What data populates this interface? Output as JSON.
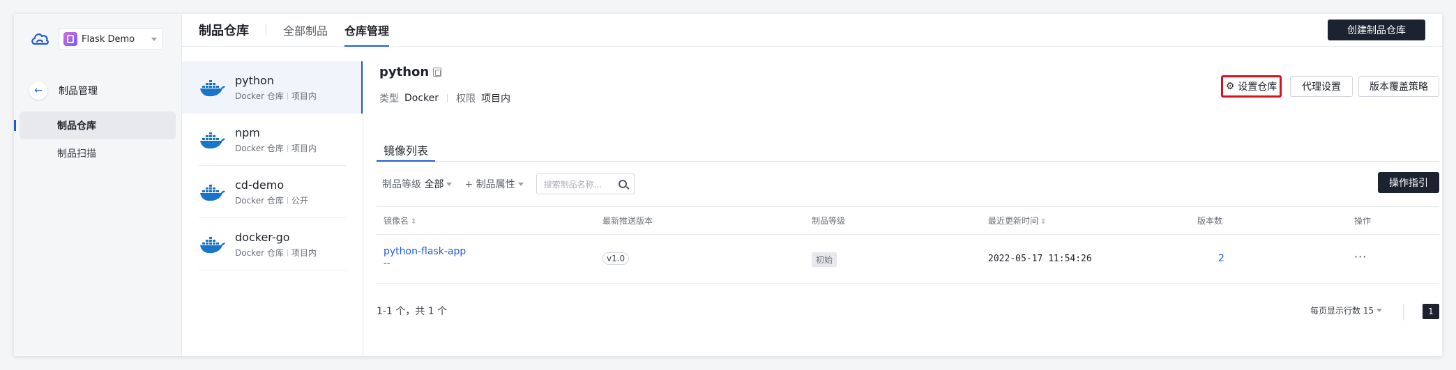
{
  "project": {
    "name": "Flask Demo"
  },
  "nav": {
    "back_label": "制品管理",
    "items": [
      {
        "label": "制品仓库",
        "active": true
      },
      {
        "label": "制品扫描",
        "active": false
      }
    ]
  },
  "header": {
    "title": "制品仓库",
    "tabs": [
      {
        "label": "全部制品",
        "active": false
      },
      {
        "label": "仓库管理",
        "active": true
      }
    ],
    "create_button": "创建制品仓库"
  },
  "repos": [
    {
      "name": "python",
      "type": "Docker 仓库",
      "scope": "项目内"
    },
    {
      "name": "npm",
      "type": "Docker 仓库",
      "scope": "项目内"
    },
    {
      "name": "cd-demo",
      "type": "Docker 仓库",
      "scope": "公开"
    },
    {
      "name": "docker-go",
      "type": "Docker 仓库",
      "scope": "项目内"
    }
  ],
  "detail": {
    "name": "python",
    "type_label": "类型",
    "type_value": "Docker",
    "perm_label": "权限",
    "perm_value": "项目内",
    "buttons": {
      "settings": "设置仓库",
      "proxy": "代理设置",
      "override": "版本覆盖策略"
    },
    "sub_tab": "镜像列表",
    "filters": {
      "level_label": "制品等级",
      "level_value": "全部",
      "attr_label": "+ 制品属性",
      "search_placeholder": "搜索制品名称..."
    },
    "guide_button": "操作指引",
    "table": {
      "headers": [
        "镜像名",
        "最新推送版本",
        "制品等级",
        "最近更新时间",
        "版本数",
        "操作"
      ],
      "rows": [
        {
          "name": "python-flask-app",
          "desc": "--",
          "version": "v1.0",
          "level": "初始",
          "updated": "2022-05-17 11:54:26",
          "count": "2",
          "action": "···"
        }
      ]
    },
    "footer": {
      "total": "1-1 个，共 1 个",
      "page_size": "每页显示行数 15",
      "page": "1"
    }
  }
}
